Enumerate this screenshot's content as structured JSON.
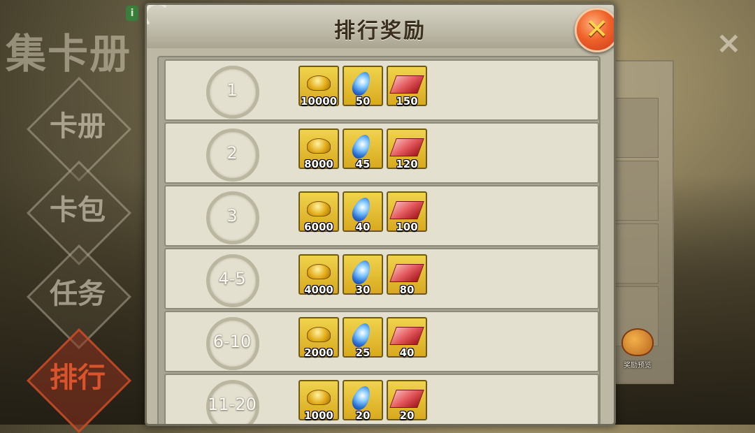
{
  "background": {
    "left_menu": {
      "title": "集卡册",
      "items": [
        {
          "label": "卡册",
          "active": false
        },
        {
          "label": "卡包",
          "active": false
        },
        {
          "label": "任务",
          "active": false
        },
        {
          "label": "排行",
          "active": true
        }
      ]
    },
    "info_badge": "i",
    "reward_preview_label": "奖励预览",
    "close_icon": "×"
  },
  "dialog": {
    "title": "排行奖励",
    "close_symbol": "✕",
    "rows": [
      {
        "rank": "1",
        "rewards": [
          {
            "icon": "gold-ingot-icon",
            "qty": "10000"
          },
          {
            "icon": "peacock-feather-icon",
            "qty": "50"
          },
          {
            "icon": "red-cloth-icon",
            "qty": "150"
          }
        ]
      },
      {
        "rank": "2",
        "rewards": [
          {
            "icon": "gold-ingot-icon",
            "qty": "8000"
          },
          {
            "icon": "peacock-feather-icon",
            "qty": "45"
          },
          {
            "icon": "red-cloth-icon",
            "qty": "120"
          }
        ]
      },
      {
        "rank": "3",
        "rewards": [
          {
            "icon": "gold-ingot-icon",
            "qty": "6000"
          },
          {
            "icon": "peacock-feather-icon",
            "qty": "40"
          },
          {
            "icon": "red-cloth-icon",
            "qty": "100"
          }
        ]
      },
      {
        "rank": "4-5",
        "rewards": [
          {
            "icon": "gold-ingot-icon",
            "qty": "4000"
          },
          {
            "icon": "peacock-feather-icon",
            "qty": "30"
          },
          {
            "icon": "red-cloth-icon",
            "qty": "80"
          }
        ]
      },
      {
        "rank": "6-10",
        "rewards": [
          {
            "icon": "gold-ingot-icon",
            "qty": "2000"
          },
          {
            "icon": "peacock-feather-icon",
            "qty": "25"
          },
          {
            "icon": "red-cloth-icon",
            "qty": "40"
          }
        ]
      },
      {
        "rank": "11-20",
        "rewards": [
          {
            "icon": "gold-ingot-icon",
            "qty": "1000"
          },
          {
            "icon": "peacock-feather-icon",
            "qty": "20"
          },
          {
            "icon": "red-cloth-icon",
            "qty": "20"
          }
        ]
      }
    ]
  },
  "colors": {
    "dialog_bg": "#bdb8a4",
    "row_bg": "#e4e0d0",
    "item_bg": "#f0d34c",
    "close_button": "#f0622a",
    "active_menu": "#d9542c"
  }
}
